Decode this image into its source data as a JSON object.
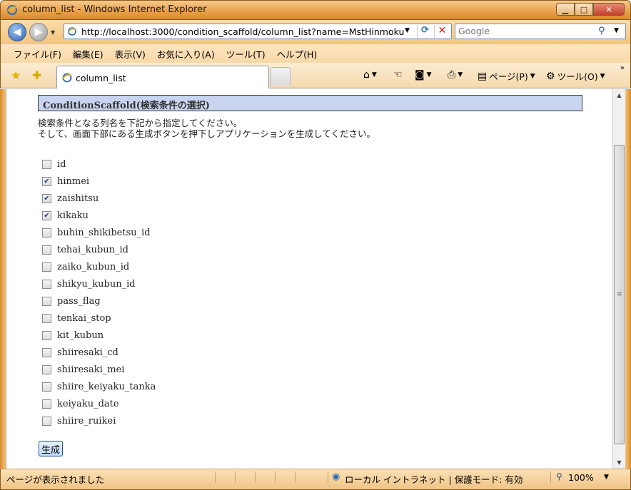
{
  "window": {
    "title": "column_list - Windows Internet Explorer",
    "icon": "ie-icon",
    "controls": [
      "minimize-icon",
      "maximize-icon",
      "close-icon"
    ]
  },
  "address": {
    "url": "http://localhost:3000/condition_scaffold/column_list?name=MstHinmoku"
  },
  "search": {
    "placeholder": "Google"
  },
  "menu": [
    "ファイル(F)",
    "編集(E)",
    "表示(V)",
    "お気に入り(A)",
    "ツール(T)",
    "ヘルプ(H)"
  ],
  "tabs": [
    {
      "label": "column_list"
    }
  ],
  "commands": {
    "page": "ページ(P)",
    "tools": "ツール(O)"
  },
  "page": {
    "heading": "ConditionScaffold(検索条件の選択)",
    "description_line1": "検索条件となる列名を下記から指定してください。",
    "description_line2": "そして、画面下部にある生成ボタンを押下しアプリケーションを生成してください。",
    "columns": [
      {
        "name": "id",
        "checked": false
      },
      {
        "name": "hinmei",
        "checked": true
      },
      {
        "name": "zaishitsu",
        "checked": true
      },
      {
        "name": "kikaku",
        "checked": true
      },
      {
        "name": "buhin_shikibetsu_id",
        "checked": false
      },
      {
        "name": "tehai_kubun_id",
        "checked": false
      },
      {
        "name": "zaiko_kubun_id",
        "checked": false
      },
      {
        "name": "shikyu_kubun_id",
        "checked": false
      },
      {
        "name": "pass_flag",
        "checked": false
      },
      {
        "name": "tenkai_stop",
        "checked": false
      },
      {
        "name": "kit_kubun",
        "checked": false
      },
      {
        "name": "shiiresaki_cd",
        "checked": false
      },
      {
        "name": "shiiresaki_mei",
        "checked": false
      },
      {
        "name": "shiire_keiyaku_tanka",
        "checked": false
      },
      {
        "name": "keiyaku_date",
        "checked": false
      },
      {
        "name": "shiire_ruikei",
        "checked": false
      }
    ],
    "generate_button": "生成"
  },
  "status": {
    "text": "ページが表示されました",
    "zone": "ローカル イントラネット | 保護モード: 有効",
    "zoom": "100%"
  },
  "colors": {
    "frame": "#e9a24e",
    "heading_bg": "#c8d4f0",
    "check": "#1a3e8c"
  }
}
